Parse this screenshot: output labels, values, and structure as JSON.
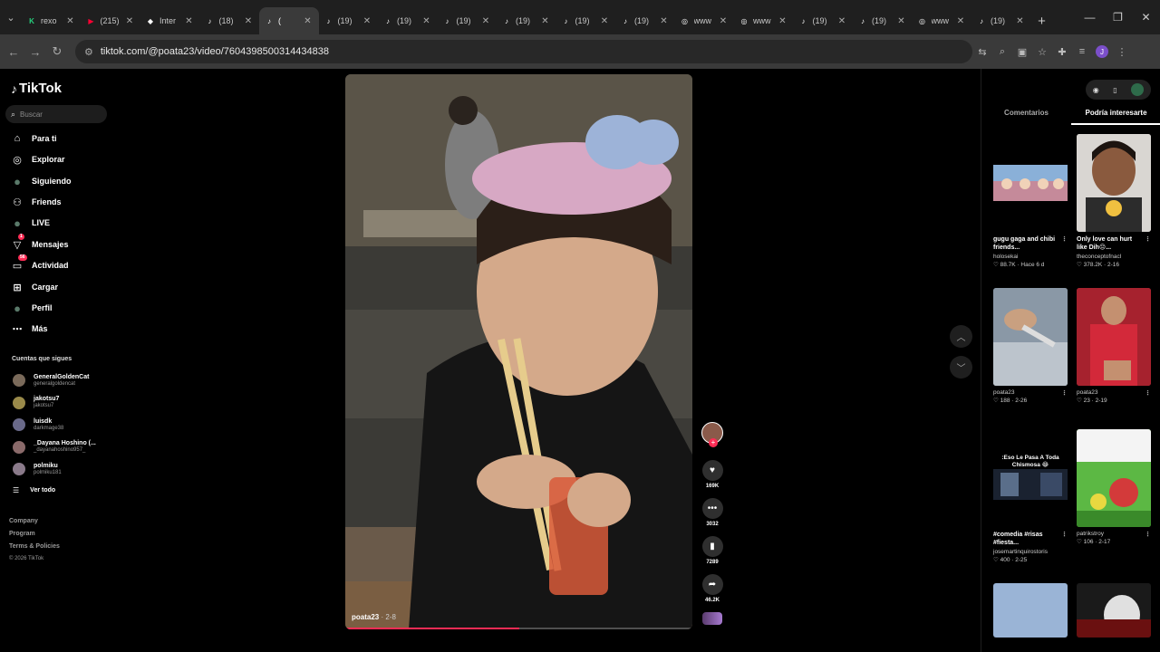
{
  "browser": {
    "tabs": [
      {
        "label": "rexo",
        "fav": "K",
        "color": "#26d07c"
      },
      {
        "label": "(215)",
        "fav": "▶",
        "color": "#ff0033"
      },
      {
        "label": "Inter",
        "fav": "◆",
        "color": "#ffffff"
      },
      {
        "label": "(18)",
        "fav": "♪",
        "color": "#ffffff"
      },
      {
        "label": "(",
        "fav": "♪",
        "color": "#ffffff",
        "active": true
      },
      {
        "label": "(19)",
        "fav": "♪",
        "color": "#ffffff"
      },
      {
        "label": "(19)",
        "fav": "♪",
        "color": "#ffffff"
      },
      {
        "label": "(19)",
        "fav": "♪",
        "color": "#ffffff"
      },
      {
        "label": "(19)",
        "fav": "♪",
        "color": "#ffffff"
      },
      {
        "label": "(19)",
        "fav": "♪",
        "color": "#ffffff"
      },
      {
        "label": "(19)",
        "fav": "♪",
        "color": "#ffffff"
      },
      {
        "label": "www",
        "fav": "◎",
        "color": "#ffffff"
      },
      {
        "label": "www",
        "fav": "◎",
        "color": "#ffffff"
      },
      {
        "label": "(19)",
        "fav": "♪",
        "color": "#ffffff"
      },
      {
        "label": "(19)",
        "fav": "♪",
        "color": "#ffffff"
      },
      {
        "label": "www",
        "fav": "◎",
        "color": "#ffffff"
      },
      {
        "label": "(19)",
        "fav": "♪",
        "color": "#ffffff"
      }
    ],
    "url": "tiktok.com/@poata23/video/7604398500314434838",
    "profile_initial": "J"
  },
  "sidebar": {
    "logo": "TikTok",
    "search_placeholder": "Buscar",
    "nav": [
      {
        "label": "Para ti",
        "icon": "home-icon",
        "glyph": "⌂"
      },
      {
        "label": "Explorar",
        "icon": "compass-icon",
        "glyph": "◎"
      },
      {
        "label": "Siguiendo",
        "icon": "following-avatar-icon",
        "glyph": "●"
      },
      {
        "label": "Friends",
        "icon": "friends-icon",
        "glyph": "⚇"
      },
      {
        "label": "LIVE",
        "icon": "live-avatar-icon",
        "glyph": "●"
      },
      {
        "label": "Mensajes",
        "icon": "send-icon",
        "glyph": "▽",
        "badge": "1"
      },
      {
        "label": "Actividad",
        "icon": "inbox-icon",
        "glyph": "▭",
        "badge": "56"
      },
      {
        "label": "Cargar",
        "icon": "upload-icon",
        "glyph": "⊞"
      },
      {
        "label": "Perfil",
        "icon": "profile-avatar-icon",
        "glyph": "●"
      },
      {
        "label": "Más",
        "icon": "more-icon",
        "glyph": "⋯"
      }
    ],
    "following_title": "Cuentas que sigues",
    "following": [
      {
        "name": "GeneralGoldenCat",
        "handle": "generalgoldencat"
      },
      {
        "name": "jakotsu7",
        "handle": "jakotsu7"
      },
      {
        "name": "luisdk",
        "handle": "darkmage38"
      },
      {
        "name": "_Dayana Hoshino (...",
        "handle": "_dayanahoshino957_"
      },
      {
        "name": "polmiku",
        "handle": "polmiku181"
      }
    ],
    "see_all": "Ver todo",
    "footer": [
      "Company",
      "Program",
      "Terms & Policies"
    ],
    "copyright": "© 2026 TikTok"
  },
  "video": {
    "author": "poata23",
    "date": "2-8",
    "progress": 0.5,
    "likes": "169K",
    "comments": "3032",
    "saves": "7289",
    "shares": "46.2K"
  },
  "right_panel": {
    "tabs": [
      "Comentarios",
      "Podría interesarte"
    ],
    "cards": [
      {
        "title": "gugu gaga and chibi friends...",
        "author": "holosekai",
        "meta": "♡ 88.7K · Hace 6 d"
      },
      {
        "title": "Only love can hurt like Dih😔...",
        "author": "theconceptofnacl",
        "meta": "♡ 378.2K · 2-16"
      },
      {
        "title": "",
        "author": "poata23",
        "meta": "♡ 188 · 2-26"
      },
      {
        "title": "",
        "author": "poata23",
        "meta": "♡ 23 · 2-19"
      },
      {
        "title": "#comedia #risas #fiesta...",
        "author": "josemartinquirostoris",
        "meta": "♡ 400 · 2-25"
      },
      {
        "title": "",
        "author": "patrikstroy",
        "meta": "♡ 106 · 2-17"
      }
    ],
    "overlay_text_1": ":Eso Le Pasa A Toda Chismosa 😂"
  }
}
